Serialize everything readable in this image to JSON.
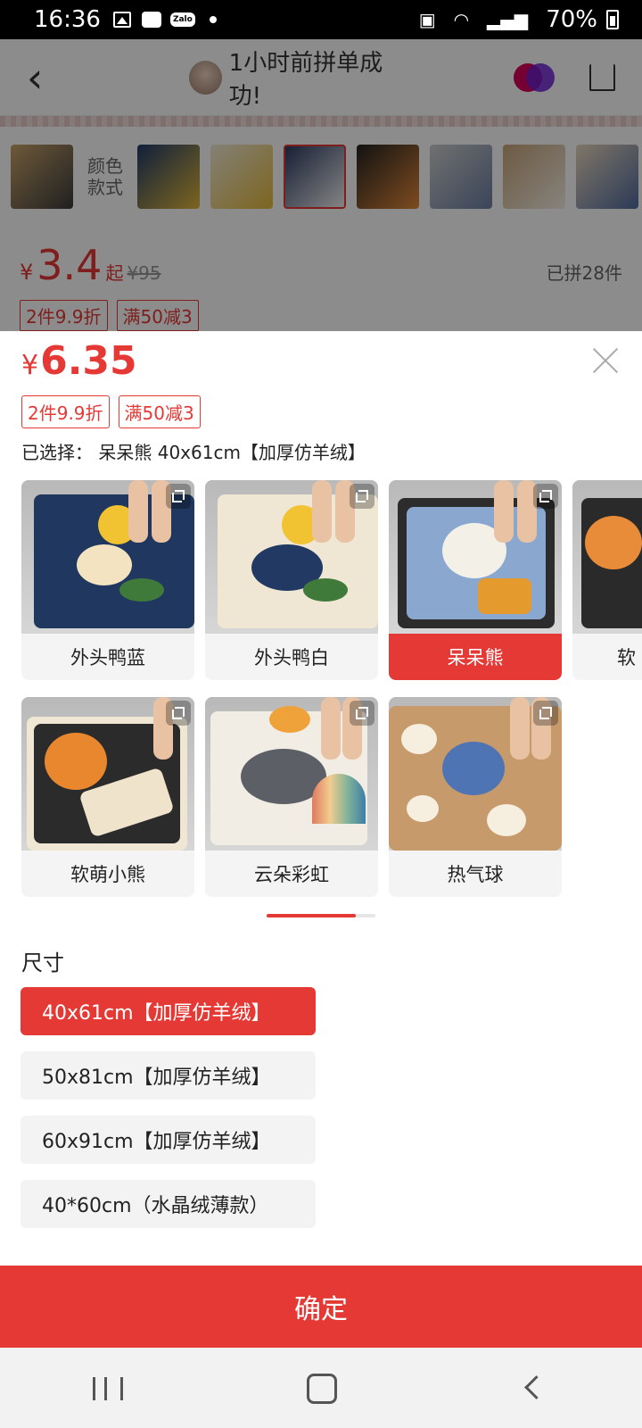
{
  "status_bar": {
    "time": "16:36",
    "zalo_label": "Zalo",
    "battery": "70%"
  },
  "background_page": {
    "header_title": "1小时前拼单成功!",
    "color_label": "颜色\n款式",
    "currency": "¥",
    "price": "3.4",
    "price_suffix": "起",
    "original_price": "¥95",
    "sold": "已拼28件",
    "tags": [
      "2件9.9折",
      "满50减3"
    ]
  },
  "sheet": {
    "currency": "¥",
    "price": "6.35",
    "tags": [
      "2件9.9折",
      "满50减3"
    ],
    "selected_text": "已选择：  呆呆熊 40x61cm【加厚仿羊绒】",
    "variants": [
      {
        "label": "外头鸭蓝",
        "selected": false
      },
      {
        "label": "外头鸭白",
        "selected": false
      },
      {
        "label": "呆呆熊",
        "selected": true
      },
      {
        "label": "软",
        "selected": false
      },
      {
        "label": "软萌小熊",
        "selected": false
      },
      {
        "label": "云朵彩虹",
        "selected": false
      },
      {
        "label": "热气球",
        "selected": false
      }
    ],
    "size_title": "尺寸",
    "sizes": [
      {
        "label": "40x61cm【加厚仿羊绒】",
        "selected": true
      },
      {
        "label": "50x81cm【加厚仿羊绒】",
        "selected": false
      },
      {
        "label": "60x91cm【加厚仿羊绒】",
        "selected": false
      },
      {
        "label": "40*60cm（水晶绒薄款）",
        "selected": false
      }
    ],
    "confirm_label": "确定"
  },
  "nav_bar": {
    "icons": [
      "recent-apps-icon",
      "home-icon",
      "back-icon"
    ]
  },
  "colors": {
    "accent": "#e53935",
    "status_bar": "#000000"
  }
}
